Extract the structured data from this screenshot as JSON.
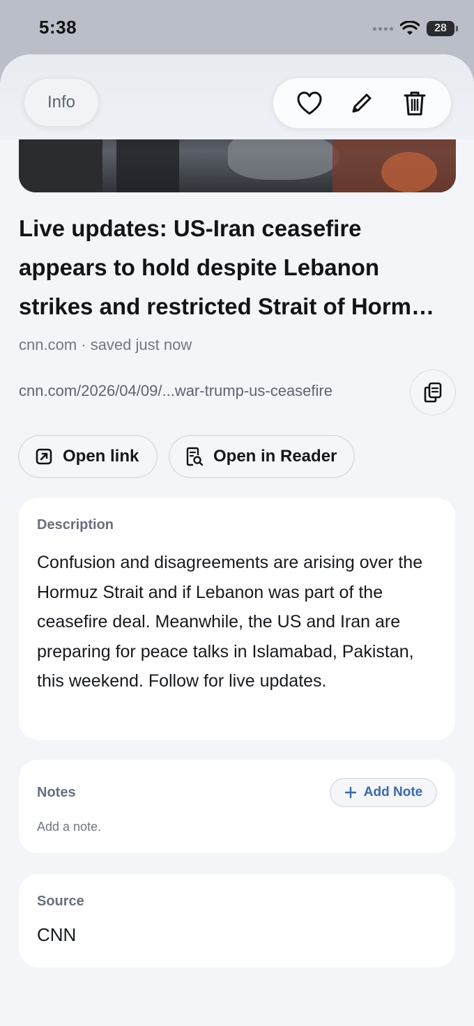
{
  "status_bar": {
    "time": "5:38",
    "battery": "28"
  },
  "toolbar": {
    "info_label": "Info",
    "icons": [
      "heart-icon",
      "pencil-icon",
      "trash-icon"
    ]
  },
  "article": {
    "title_lines": [
      "Live updates: US-Iran ceasefire",
      "appears to hold despite Lebanon",
      "strikes and restricted Strait of Horm…"
    ],
    "meta": "cnn.com · saved just now",
    "url": "cnn.com/2026/04/09/...war-trump-us-ceasefire"
  },
  "actions": {
    "open_link": "Open link",
    "open_reader": "Open in Reader"
  },
  "description": {
    "label": "Description",
    "text": "Confusion and disagreements are arising over the Hormuz Strait and if Lebanon was part of the ceasefire deal. Meanwhile, the US and Iran are preparing for peace talks in Islamabad, Pakistan, this weekend. Follow for live updates."
  },
  "notes": {
    "label": "Notes",
    "add_label": "Add Note",
    "placeholder": "Add a note."
  },
  "source": {
    "label": "Source",
    "value": "CNN"
  },
  "colors": {
    "accent": "#3a6aa8",
    "sheet_bg": "#f3f5f9",
    "card_bg": "#ffffff"
  }
}
